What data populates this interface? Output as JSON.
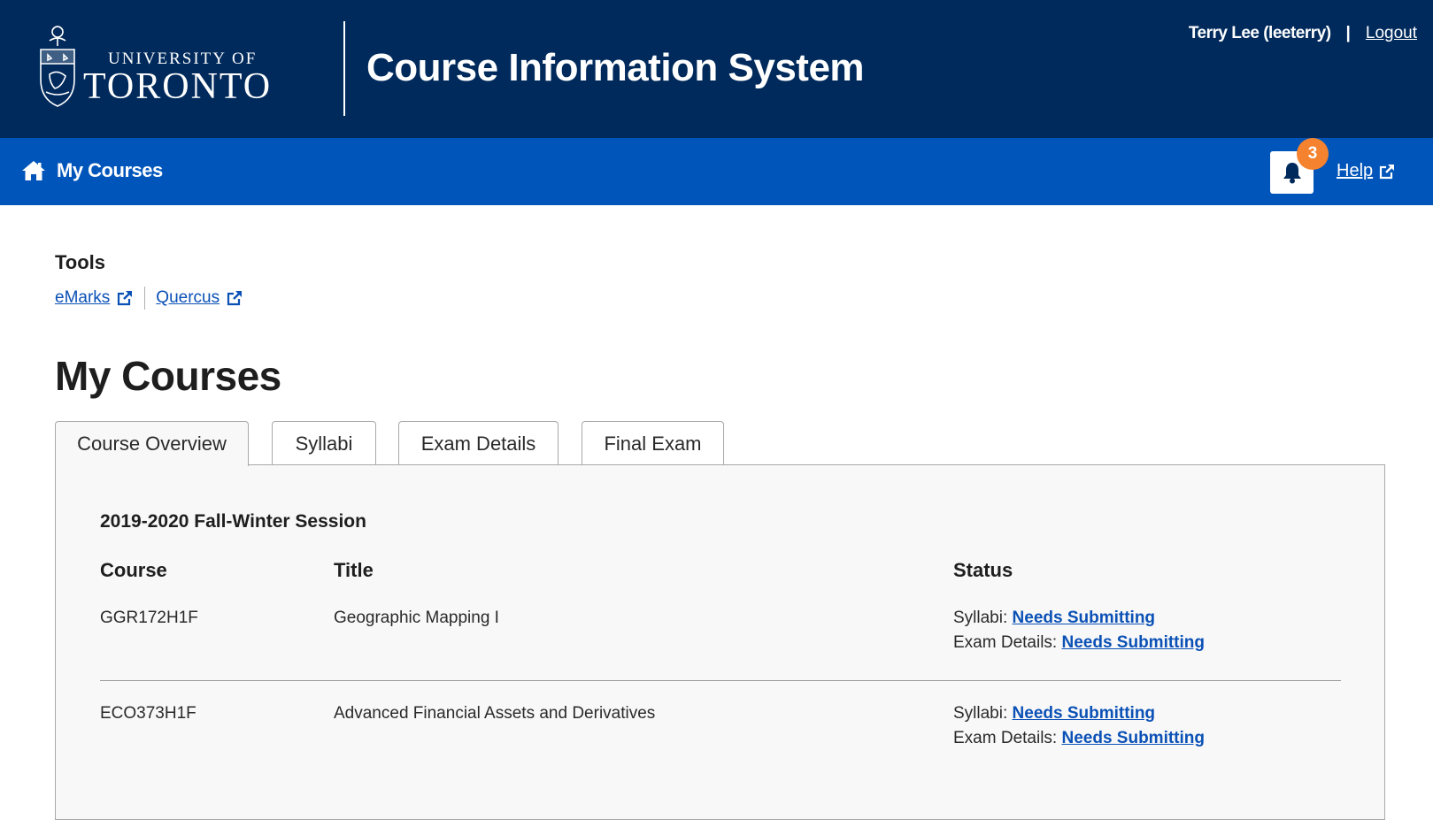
{
  "header": {
    "logo_top": "UNIVERSITY OF",
    "logo_main": "TORONTO",
    "app_title": "Course Information System",
    "user_name": "Terry Lee (leeterry)",
    "separator": "|",
    "logout_label": "Logout"
  },
  "nav": {
    "home_icon": "home-icon",
    "home_label": "My Courses",
    "bell_icon": "bell-icon",
    "notification_count": "3",
    "help_label": "Help",
    "external_icon": "external-link-icon"
  },
  "tools": {
    "heading": "Tools",
    "links": [
      {
        "label": "eMarks"
      },
      {
        "label": "Quercus"
      }
    ]
  },
  "page_title": "My Courses",
  "tabs": [
    {
      "label": "Course Overview",
      "active": true
    },
    {
      "label": "Syllabi",
      "active": false
    },
    {
      "label": "Exam Details",
      "active": false
    },
    {
      "label": "Final Exam",
      "active": false
    }
  ],
  "overview": {
    "session": "2019-2020 Fall-Winter Session",
    "columns": {
      "course": "Course",
      "title": "Title",
      "status": "Status"
    },
    "rows": [
      {
        "course": "GGR172H1F",
        "title": "Geographic Mapping I",
        "syllabi_label": "Syllabi:",
        "syllabi_status": "Needs Submitting",
        "exam_label": "Exam Details:",
        "exam_status": "Needs Submitting"
      },
      {
        "course": "ECO373H1F",
        "title": "Advanced Financial Assets and Derivatives",
        "syllabi_label": "Syllabi:",
        "syllabi_status": "Needs Submitting",
        "exam_label": "Exam Details:",
        "exam_status": "Needs Submitting"
      }
    ]
  },
  "colors": {
    "header_bg": "#002a5c",
    "nav_bg": "#0055bb",
    "badge": "#f4822e",
    "link": "#0b51b6"
  }
}
